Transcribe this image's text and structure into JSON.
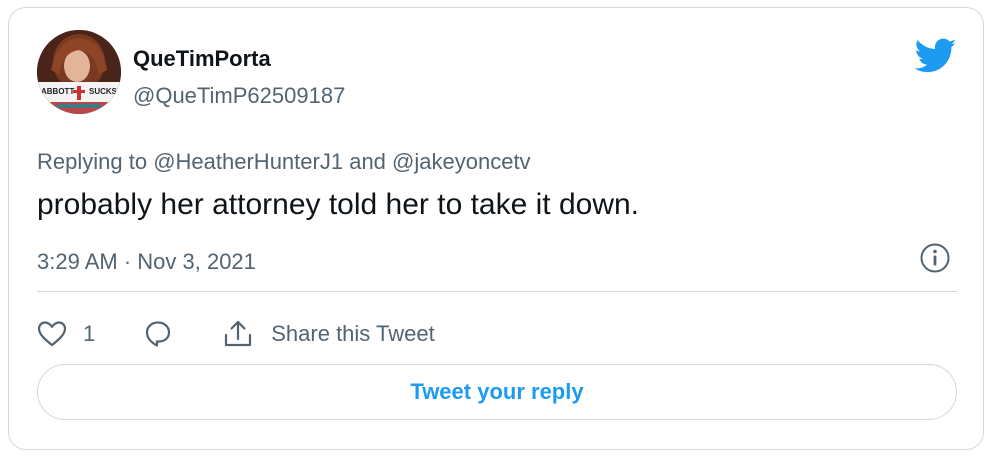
{
  "author": {
    "display_name": "QueTimPorta",
    "handle": "@QueTimP62509187",
    "avatar": {
      "text_left": "ABBOTT",
      "text_right": "SUCKS",
      "icon": "avatar-photo"
    }
  },
  "replying": {
    "prefix": "Replying to",
    "user1": "@HeatherHunterJ1",
    "conjunction": "and",
    "user2": "@jakeyoncetv"
  },
  "tweet": {
    "text": "probably her attorney told her to take it down.",
    "timestamp": "3:29 AM · Nov 3, 2021"
  },
  "actions": {
    "like_count": "1",
    "share_label": "Share this Tweet"
  },
  "reply_button": {
    "label": "Tweet your reply"
  },
  "icons": {
    "brand": "twitter-bird-icon",
    "info": "info-icon",
    "like": "heart-icon",
    "reply": "reply-bubble-icon",
    "share": "share-icon"
  },
  "colors": {
    "brand_blue": "#1d9bf0",
    "text_primary": "#0f1419",
    "text_secondary": "#536471",
    "border": "#cfd9de"
  }
}
